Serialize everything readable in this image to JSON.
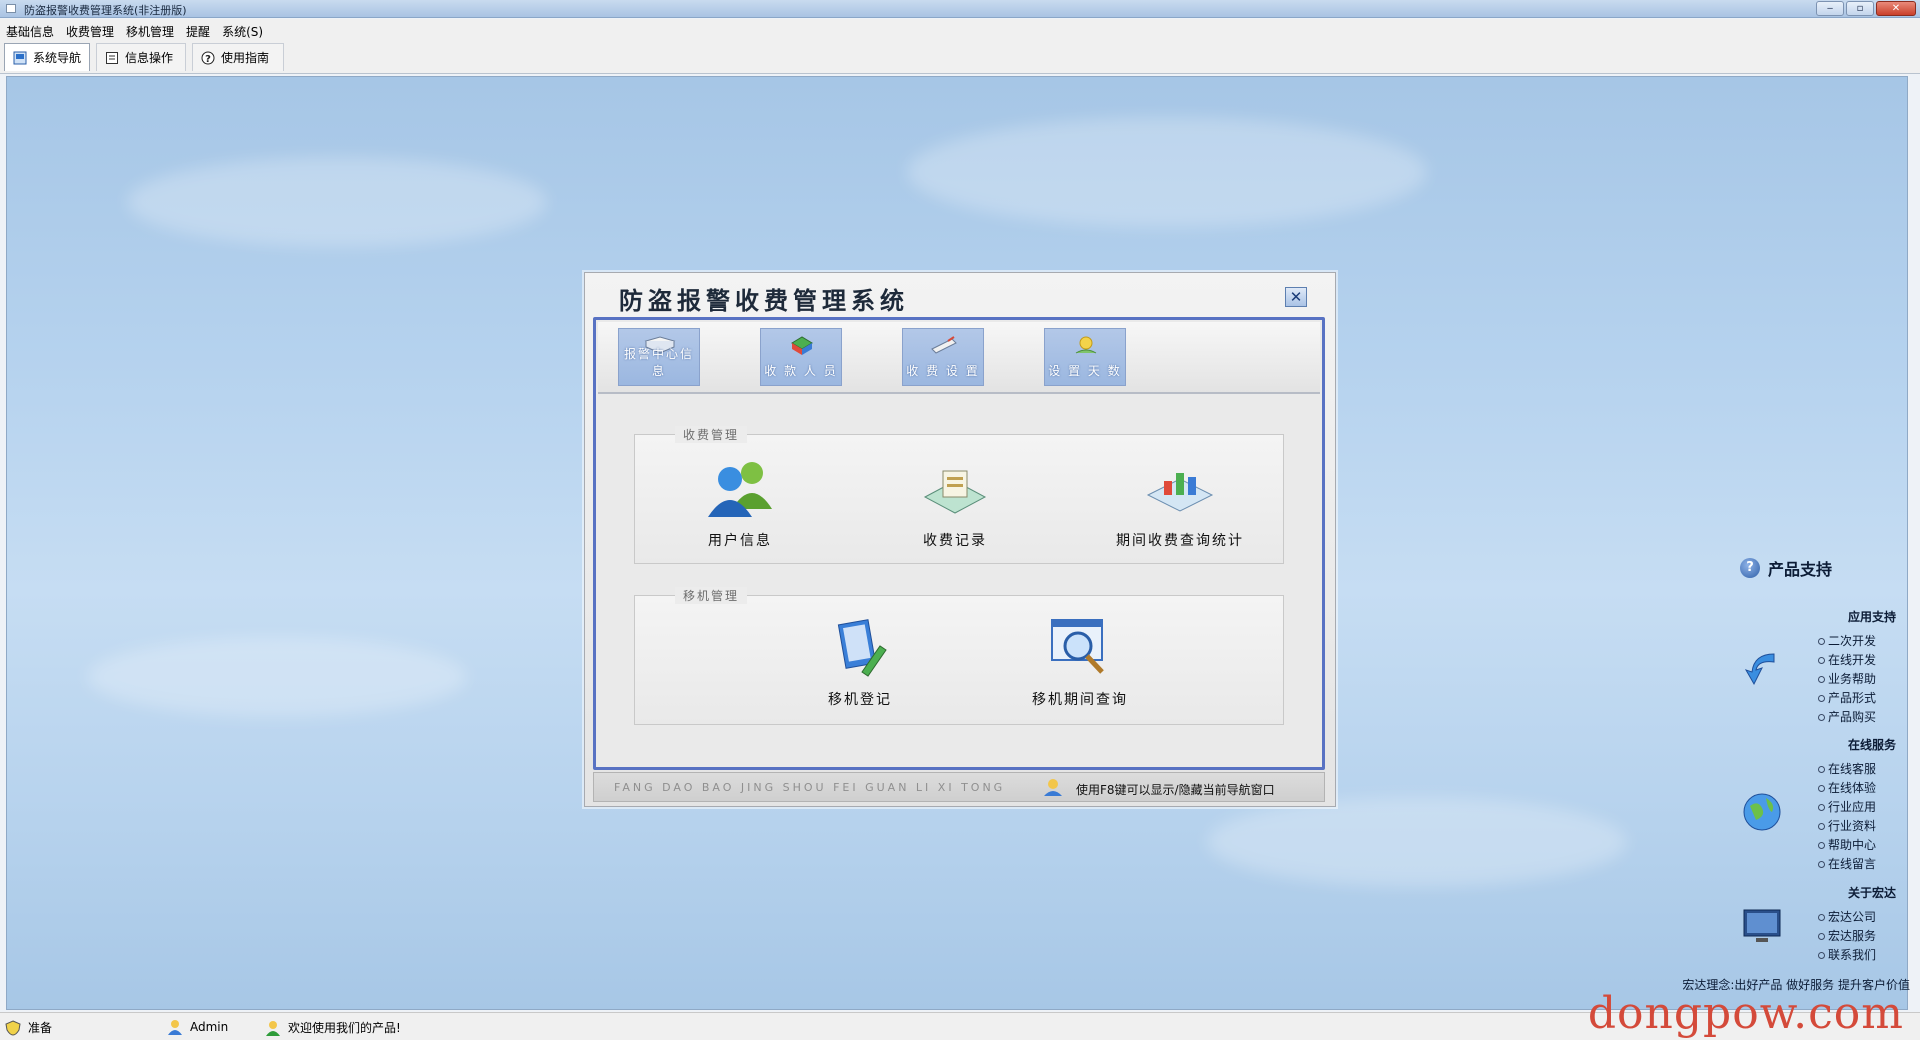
{
  "window": {
    "title": "防盗报警收费管理系统(非注册版)",
    "minimize": "‒",
    "maximize": "▫",
    "close": "✕"
  },
  "menubar": [
    "基础信息",
    "收费管理",
    "移机管理",
    "提醒",
    "系统(S)"
  ],
  "toolbar_tabs": [
    {
      "label": "系统导航",
      "icon": "nav-icon",
      "active": true
    },
    {
      "label": "信息操作",
      "icon": "document-icon",
      "active": false
    },
    {
      "label": "使用指南",
      "icon": "help-icon",
      "active": false
    }
  ],
  "dialog": {
    "title": "防盗报警收费管理系统",
    "close_label": "✕",
    "top_buttons": [
      "报警中心信息",
      "收 款 人 员",
      "收 费 设 置",
      "设 置 天 数"
    ],
    "groups": [
      {
        "legend": "收费管理",
        "items": [
          "用户信息",
          "收费记录",
          "期间收费查询统计"
        ]
      },
      {
        "legend": "移机管理",
        "items": [
          "移机登记",
          "移机期间查询"
        ]
      }
    ],
    "footer_pinyin": "FANG DAO BAO JING SHOU FEI GUAN LI XI TONG",
    "footer_hint": "使用F8键可以显示/隐藏当前导航窗口"
  },
  "support": {
    "title": "产品支持",
    "sections": [
      {
        "heading": "应用支持",
        "icon": "arrow-icon",
        "links": [
          "二次开发",
          "在线开发",
          "业务帮助",
          "产品形式",
          "产品购买"
        ]
      },
      {
        "heading": "在线服务",
        "icon": "globe-icon",
        "links": [
          "在线客服",
          "在线体验",
          "行业应用",
          "行业资料",
          "帮助中心",
          "在线留言"
        ]
      },
      {
        "heading": "关于宏达",
        "icon": "monitor-icon",
        "links": [
          "宏达公司",
          "宏达服务",
          "联系我们"
        ]
      }
    ],
    "motto": "宏达理念:出好产品 做好服务 提升客户价值"
  },
  "statusbar": {
    "status": "准备",
    "user": "Admin",
    "welcome": "欢迎使用我们的产品!"
  },
  "watermark": "dongpow.com"
}
